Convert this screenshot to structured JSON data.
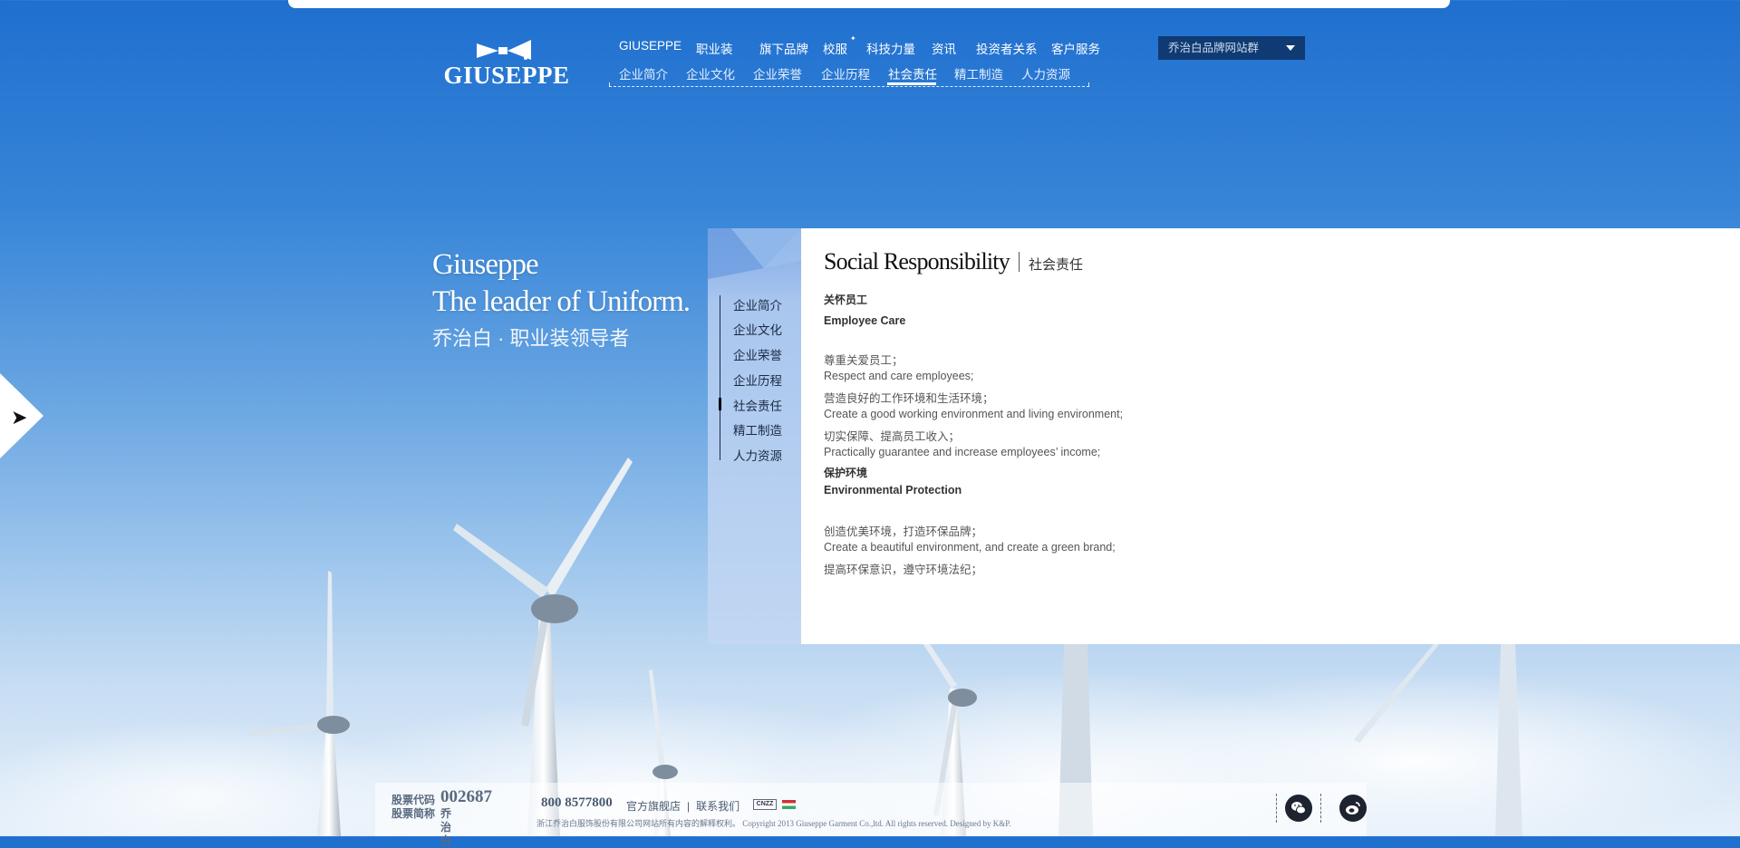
{
  "brand": {
    "logo_text": "GIUSEPPE"
  },
  "nav_main": [
    {
      "label": "GIUSEPPE"
    },
    {
      "label": "职业装"
    },
    {
      "label": "旗下品牌"
    },
    {
      "label": "校服"
    },
    {
      "label": "科技力量"
    },
    {
      "label": "资讯"
    },
    {
      "label": "投资者关系"
    },
    {
      "label": "客户服务"
    }
  ],
  "nav_sub": [
    {
      "label": "企业简介"
    },
    {
      "label": "企业文化"
    },
    {
      "label": "企业荣誉"
    },
    {
      "label": "企业历程"
    },
    {
      "label": "社会责任"
    },
    {
      "label": "精工制造"
    },
    {
      "label": "人力资源"
    }
  ],
  "site_select": {
    "label": "乔治白品牌网站群"
  },
  "slogan": {
    "line1": "Giuseppe",
    "line2": "The leader of Uniform.",
    "line3": "乔治白 · 职业装领导者"
  },
  "side_menu": [
    {
      "label": "企业简介"
    },
    {
      "label": "企业文化"
    },
    {
      "label": "企业荣誉"
    },
    {
      "label": "企业历程"
    },
    {
      "label": "社会责任"
    },
    {
      "label": "精工制造"
    },
    {
      "label": "人力资源"
    }
  ],
  "content": {
    "title_en": "Social Responsibility",
    "title_cn": "社会责任",
    "lines": [
      "关怀员工",
      "Employee Care",
      "尊重关爱员工；",
      "Respect and care employees;",
      "营造良好的工作环境和生活环境；",
      "Create a good working environment and living environment;",
      "切实保障、提高员工收入；",
      "Practically guarantee and increase employees’ income;",
      "保护环境",
      "Environmental Protection",
      "创造优美环境，打造环保品牌；",
      "Create a beautiful environment, and create a green brand;",
      "提高环保意识，遵守环境法纪；"
    ]
  },
  "footer": {
    "stock_code_label": "股票代码",
    "stock_code": "002687",
    "stock_name_label": "股票简称",
    "stock_name": "乔治白",
    "hotline": "800 8577800",
    "link_store": "官方旗舰店",
    "link_contact": "联系我们",
    "cnzz": "CNZZ",
    "copyright": "浙江乔治白服饰股份有限公司网站所有内容的解释权利。 Copyright 2013 Giuseppe Garment Co.,ltd. All rights reserved.   Designed by K&P."
  },
  "icons": {
    "wechat": "wechat-icon",
    "weibo": "weibo-icon",
    "prev": "chevron-right-icon",
    "next": "chevron-left-icon"
  },
  "colors": {
    "select_bg": "#0f3a73",
    "side_panel": "#a9c6ee",
    "footer_icon": "#1e2330"
  }
}
